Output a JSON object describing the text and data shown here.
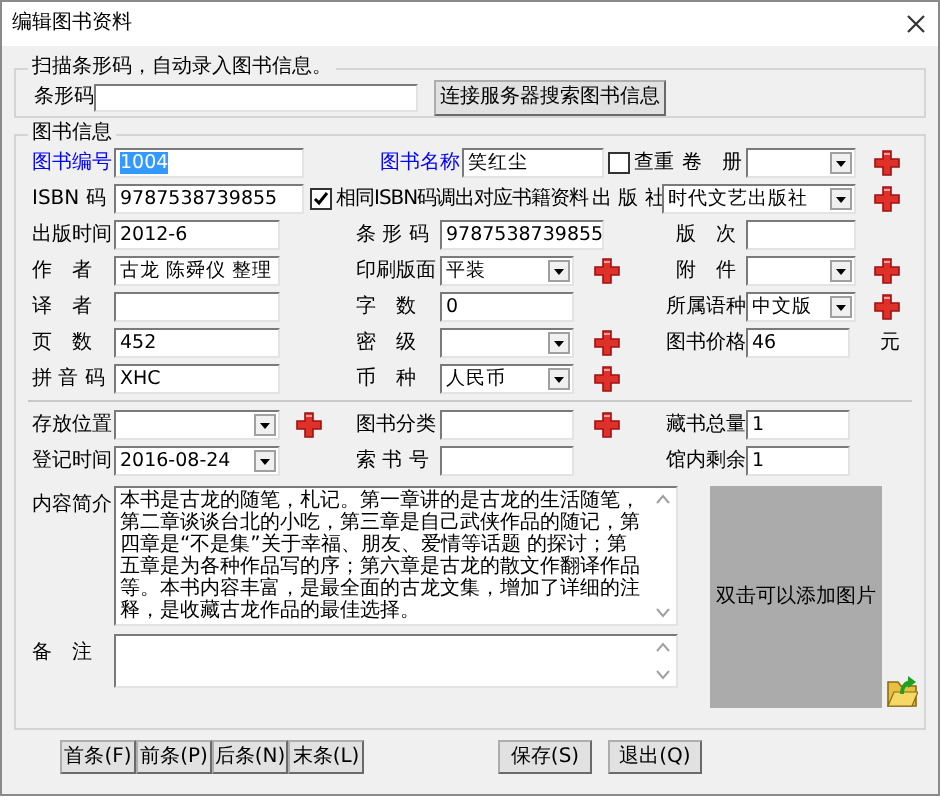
{
  "window": {
    "title": "编辑图书资料"
  },
  "scan_group": {
    "legend": "扫描条形码，自动录入图书信息。",
    "barcode_label": "条形码",
    "search_button": "连接服务器搜索图书信息"
  },
  "info_group": {
    "legend": "图书信息",
    "rows": [
      [
        {
          "label": "图书编号",
          "color": "#0000ff",
          "field": {
            "kind": "input",
            "value": "1004",
            "text_selected": true
          }
        },
        {
          "label": "图书名称",
          "color": "#0000ff",
          "field": {
            "kind": "input",
            "value": "笑红尘"
          },
          "checkbox": {
            "label": "查重",
            "checked": false
          }
        },
        {
          "label": "卷　册",
          "field": {
            "kind": "select"
          },
          "add_button": true
        }
      ],
      [
        {
          "label": "ISBN 码",
          "field": {
            "kind": "input",
            "value": "9787538739855"
          }
        },
        {
          "checkbox": {
            "label": "相同ISBN码调出对应书籍资料",
            "checked": true
          }
        },
        {
          "label": "出 版 社",
          "field": {
            "kind": "select",
            "value": "时代文艺出版社"
          },
          "add_button": true
        }
      ],
      [
        {
          "label": "出版时间",
          "field": {
            "kind": "input",
            "value": "2012-6"
          }
        },
        {
          "label": "条 形 码",
          "field": {
            "kind": "input",
            "value": "9787538739855"
          }
        },
        {
          "label": "版　次",
          "field": {
            "kind": "input"
          }
        }
      ],
      [
        {
          "label": "作　者",
          "field": {
            "kind": "input",
            "value": "古龙 陈舜仪 整理"
          }
        },
        {
          "label": "印刷版面",
          "field": {
            "kind": "select",
            "value": "平装"
          },
          "add_button": true
        },
        {
          "label": "附　件",
          "field": {
            "kind": "select"
          },
          "add_button": true
        }
      ],
      [
        {
          "label": "译　者",
          "field": {
            "kind": "input"
          }
        },
        {
          "label": "字　数",
          "field": {
            "kind": "input",
            "value": "0"
          }
        },
        {
          "label": "所属语种",
          "field": {
            "kind": "select",
            "value": "中文版"
          },
          "add_button": true
        }
      ],
      [
        {
          "label": "页　数",
          "field": {
            "kind": "input",
            "value": "452"
          }
        },
        {
          "label": "密　级",
          "field": {
            "kind": "select"
          },
          "add_button": true
        },
        {
          "label": "图书价格",
          "field": {
            "kind": "input",
            "value": "46"
          },
          "unit": "元"
        }
      ],
      [
        {
          "label": "拼 音 码",
          "field": {
            "kind": "input",
            "value": "XHC"
          }
        },
        {
          "label": "币　种",
          "field": {
            "kind": "select",
            "value": "人民币"
          },
          "add_button": true
        }
      ]
    ],
    "location_rows": [
      [
        {
          "label": "存放位置",
          "field": {
            "kind": "select"
          },
          "add_button": true
        },
        {
          "label": "图书分类",
          "field": {
            "kind": "input"
          },
          "add_button": true
        },
        {
          "label": "藏书总量",
          "field": {
            "kind": "input",
            "value": "1"
          }
        }
      ],
      [
        {
          "label": "登记时间",
          "field": {
            "kind": "select",
            "value": "2016-08-24"
          }
        },
        {
          "label": "索 书 号",
          "field": {
            "kind": "input"
          }
        },
        {
          "label": "馆内剩余",
          "field": {
            "kind": "input",
            "value": "1"
          }
        }
      ]
    ],
    "summary": {
      "label": "内容简介",
      "text": "本书是古龙的随笔，札记。第一章讲的是古龙的生活随笔，第二章谈谈台北的小吃，第三章是自己武侠作品的随记，第四章是“不是集”关于幸福、朋友、爱情等话题 的探讨；第五章是为各种作品写的序；第六章是古龙的散文作翻译作品等。本书内容丰富，是最全面的古龙文集，增加了详细的注释，是收藏古龙作品的最佳选择。"
    },
    "remarks": {
      "label": "备　注"
    },
    "image_box": {
      "hint": "双击可以添加图片"
    }
  },
  "nav_buttons": [
    "首条(F)",
    "前条(P)",
    "后条(N)",
    "末条(L)"
  ],
  "action_buttons": [
    "保存(S)",
    "退出(Q)"
  ]
}
